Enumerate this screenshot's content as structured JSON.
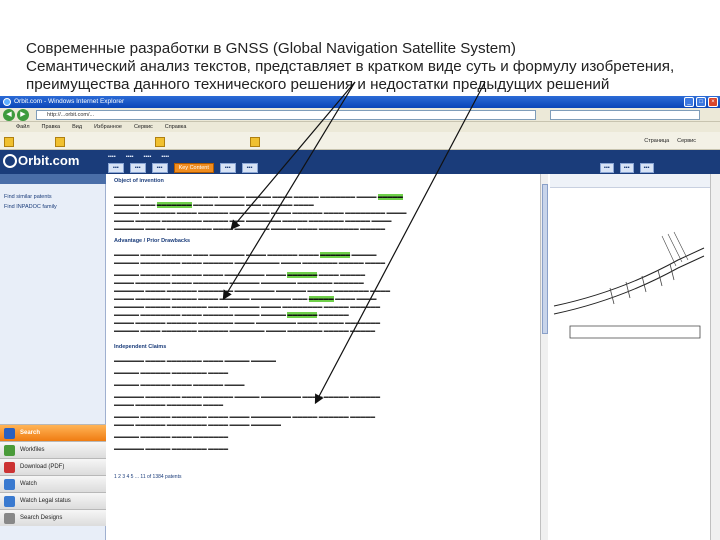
{
  "caption": {
    "line1": "Современные разработки в  GNSS (Global Navigation Satellite System)",
    "line2": "Семантический анализ текстов, представляет в кратком виде суть и формулу изобретения,",
    "line3": "преимущества данного технического решения и недостатки предыдущих решений"
  },
  "browser": {
    "title": "Orbit.com - Windows Internet Explorer",
    "url": "http://...orbit.com/...",
    "menu": [
      "Файл",
      "Правка",
      "Вид",
      "Избранное",
      "Сервис",
      "Справка"
    ],
    "toolbar": [
      "Страница",
      "Сервис"
    ]
  },
  "app": {
    "logo": "Orbit.com",
    "nav_items": [
      {
        "label": "Search"
      },
      {
        "label": "Workfiles"
      },
      {
        "label": "Download (PDF)"
      },
      {
        "label": "Watch"
      },
      {
        "label": "Watch Legal status"
      },
      {
        "label": "Search Designs"
      }
    ],
    "left_links": [
      "Find similar patents",
      "Find INPADOC family"
    ],
    "tab_key_content": "Key Content",
    "sections": {
      "object": "Object of invention",
      "advantage": "Advantage / Prior Drawbacks",
      "claims": "Independent Claims"
    },
    "status": "1 2 3 4 5 ... 11 of 1384 patents"
  },
  "colors": {
    "orbit_header": "#1a3c7a",
    "highlight": "#6fd04a",
    "selected_nav": "#f07c12",
    "annotation_arrow": "#111111"
  }
}
